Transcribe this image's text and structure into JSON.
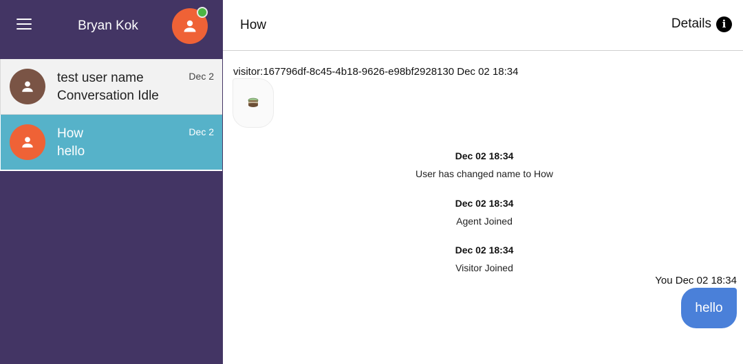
{
  "sidebar": {
    "agent_name": "Bryan Kok",
    "menu_icon": "hamburger-menu-icon",
    "avatar_icon": "person-icon",
    "status_color": "#4bb543",
    "conversations": [
      {
        "title": "test user name",
        "subtitle": "Conversation Idle",
        "date": "Dec 2",
        "avatar_color": "#7a5445"
      },
      {
        "title": "How",
        "subtitle": "hello",
        "date": "Dec 2",
        "avatar_color": "#ef6236"
      }
    ]
  },
  "header": {
    "title": "How",
    "details_label": "Details",
    "details_icon": "info-icon"
  },
  "chat": {
    "visitor_meta": "visitor:167796df-8c45-4b18-9626-e98bf2928130 Dec 02 18:34",
    "visitor_message_icon": "cake-emoji-icon",
    "events": [
      {
        "time": "Dec 02 18:34",
        "text": "User has changed name to How"
      },
      {
        "time": "Dec 02 18:34",
        "text": "Agent Joined"
      },
      {
        "time": "Dec 02 18:34",
        "text": "Visitor Joined"
      }
    ],
    "you_meta": "You Dec 02 18:34",
    "you_message": "hello"
  },
  "colors": {
    "sidebar_bg": "#433564",
    "active_item": "#56b2c9",
    "agent_bubble": "#4a80d9",
    "agent_avatar": "#ef6236"
  }
}
